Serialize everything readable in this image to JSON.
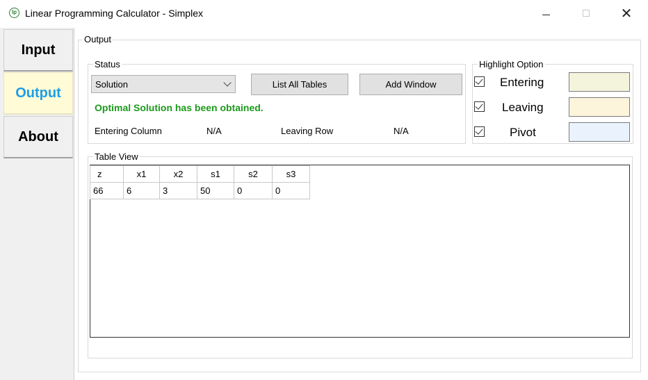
{
  "window": {
    "title": "Linear Programming Calculator - Simplex",
    "icon": "lp-logo-icon",
    "controls": {
      "minimize": "minimize-icon",
      "maximize": "maximize-icon",
      "close": "✕"
    }
  },
  "sidebar": {
    "tabs": [
      {
        "label": "Input",
        "active": false
      },
      {
        "label": "Output",
        "active": true
      },
      {
        "label": "About",
        "active": false
      }
    ]
  },
  "output": {
    "group_label": "Output",
    "status": {
      "group_label": "Status",
      "selected": "Solution",
      "list_all_tables": "List All Tables",
      "add_window": "Add Window",
      "message": "Optimal Solution has been obtained.",
      "entering_column_label": "Entering Column",
      "entering_column_value": "N/A",
      "leaving_row_label": "Leaving Row",
      "leaving_row_value": "N/A"
    },
    "highlight": {
      "group_label": "Highlight Option",
      "options": [
        {
          "label": "Entering",
          "checked": true,
          "color": "#f4f4dc"
        },
        {
          "label": "Leaving",
          "checked": true,
          "color": "#fdf4dc"
        },
        {
          "label": "Pivot",
          "checked": true,
          "color": "#eaf3fd"
        }
      ]
    },
    "table_view": {
      "group_label": "Table View",
      "columns": [
        "z",
        "x1",
        "x2",
        "s1",
        "s2",
        "s3"
      ],
      "rows": [
        [
          "66",
          "6",
          "3",
          "50",
          "0",
          "0"
        ]
      ]
    }
  },
  "colors": {
    "active_tab_bg": "#fffbd6",
    "active_tab_text": "#1e9ee8",
    "status_message": "#1a9a1a"
  }
}
